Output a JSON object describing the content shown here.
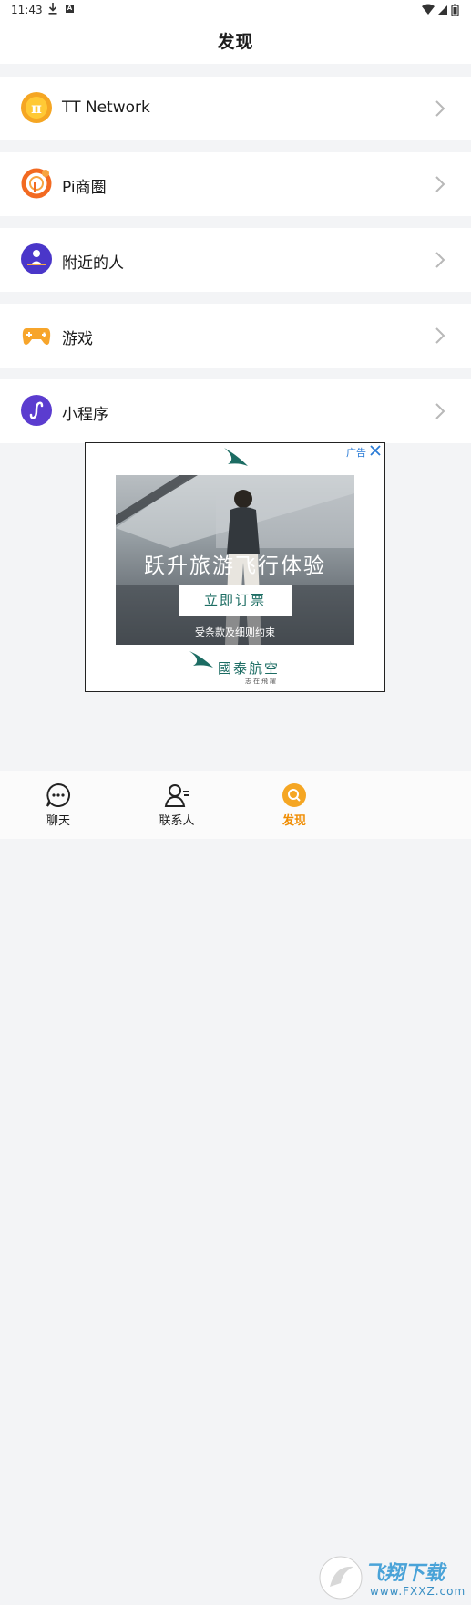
{
  "status_bar": {
    "time": "11:43"
  },
  "header": {
    "title": "发现"
  },
  "menu": [
    {
      "label": "TT Network",
      "icon": "tt-network-icon",
      "color": "#f5a623"
    },
    {
      "label": "Pi商圈",
      "icon": "pi-circle-icon",
      "color": "#f26a21"
    },
    {
      "label": "附近的人",
      "icon": "nearby-people-icon",
      "color": "#5a3fd1"
    },
    {
      "label": "游戏",
      "icon": "game-controller-icon",
      "color": "#f7a52b"
    },
    {
      "label": "小程序",
      "icon": "mini-program-icon",
      "color": "#5b3ccf"
    }
  ],
  "ad": {
    "tag": "广告",
    "headline": "跃升旅游飞行体验",
    "cta": "立即订票",
    "terms": "受条款及细则约束",
    "brand": "國泰航空",
    "slogan": "志在飛躍",
    "brand_color": "#1c6c63"
  },
  "tabs": [
    {
      "label": "聊天",
      "icon": "chat-icon",
      "active": false
    },
    {
      "label": "联系人",
      "icon": "contacts-icon",
      "active": false
    },
    {
      "label": "发现",
      "icon": "discover-icon",
      "active": true
    }
  ],
  "watermark": {
    "text": "飞翔下载",
    "sub": "www.FXXZ.com"
  },
  "colors": {
    "accent": "#f08c00",
    "background": "#f3f4f6"
  }
}
